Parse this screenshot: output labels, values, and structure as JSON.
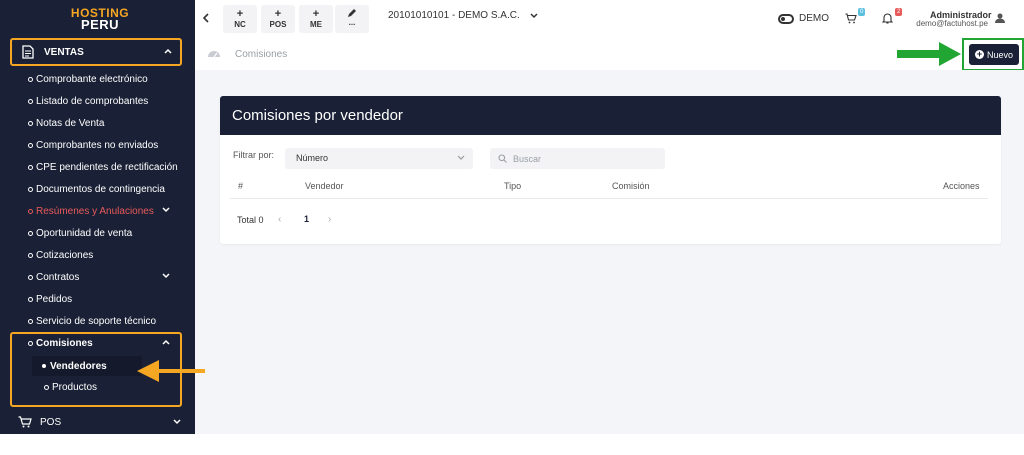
{
  "logo": {
    "line1": "HOSTING",
    "line2": "PERU"
  },
  "sidebar": {
    "section_ventas": "VENTAS",
    "items": [
      {
        "label": "Comprobante electrónico"
      },
      {
        "label": "Listado de comprobantes"
      },
      {
        "label": "Notas de Venta"
      },
      {
        "label": "Comprobantes no enviados"
      },
      {
        "label": "CPE pendientes de rectificación"
      },
      {
        "label": "Documentos de contingencia"
      },
      {
        "label": "Resúmenes y Anulaciones"
      },
      {
        "label": "Oportunidad de venta"
      },
      {
        "label": "Cotizaciones"
      },
      {
        "label": "Contratos"
      },
      {
        "label": "Pedidos"
      },
      {
        "label": "Servicio de soporte técnico"
      }
    ],
    "comisiones": {
      "label": "Comisiones",
      "sub": [
        {
          "label": "Vendedores"
        },
        {
          "label": "Productos"
        }
      ]
    },
    "pos": "POS"
  },
  "topbar": {
    "buttons": [
      {
        "plus": "+",
        "label": "NC"
      },
      {
        "plus": "+",
        "label": "POS"
      },
      {
        "plus": "+",
        "label": "ME"
      },
      {
        "plus": "",
        "label": "..."
      }
    ],
    "company": "20101010101 - DEMO S.A.C.",
    "demo": "DEMO",
    "cart_badge": "0",
    "bell_badge": "2",
    "user_name": "Administrador",
    "user_email": "demo@factuhost.pe"
  },
  "breadcrumb": {
    "text": "Comisiones"
  },
  "nuevo_button": "Nuevo",
  "card": {
    "title": "Comisiones por vendedor",
    "filter_label": "Filtrar por:",
    "filter_value": "Número",
    "search_placeholder": "Buscar",
    "columns": [
      "#",
      "Vendedor",
      "Tipo",
      "Comisión",
      "Acciones"
    ],
    "total": "Total 0",
    "page": "1"
  },
  "colors": {
    "sidebar_bg": "#1a2035",
    "accent_orange": "#f5a623",
    "accent_green": "#21a633",
    "danger_red": "#e85a5a"
  }
}
